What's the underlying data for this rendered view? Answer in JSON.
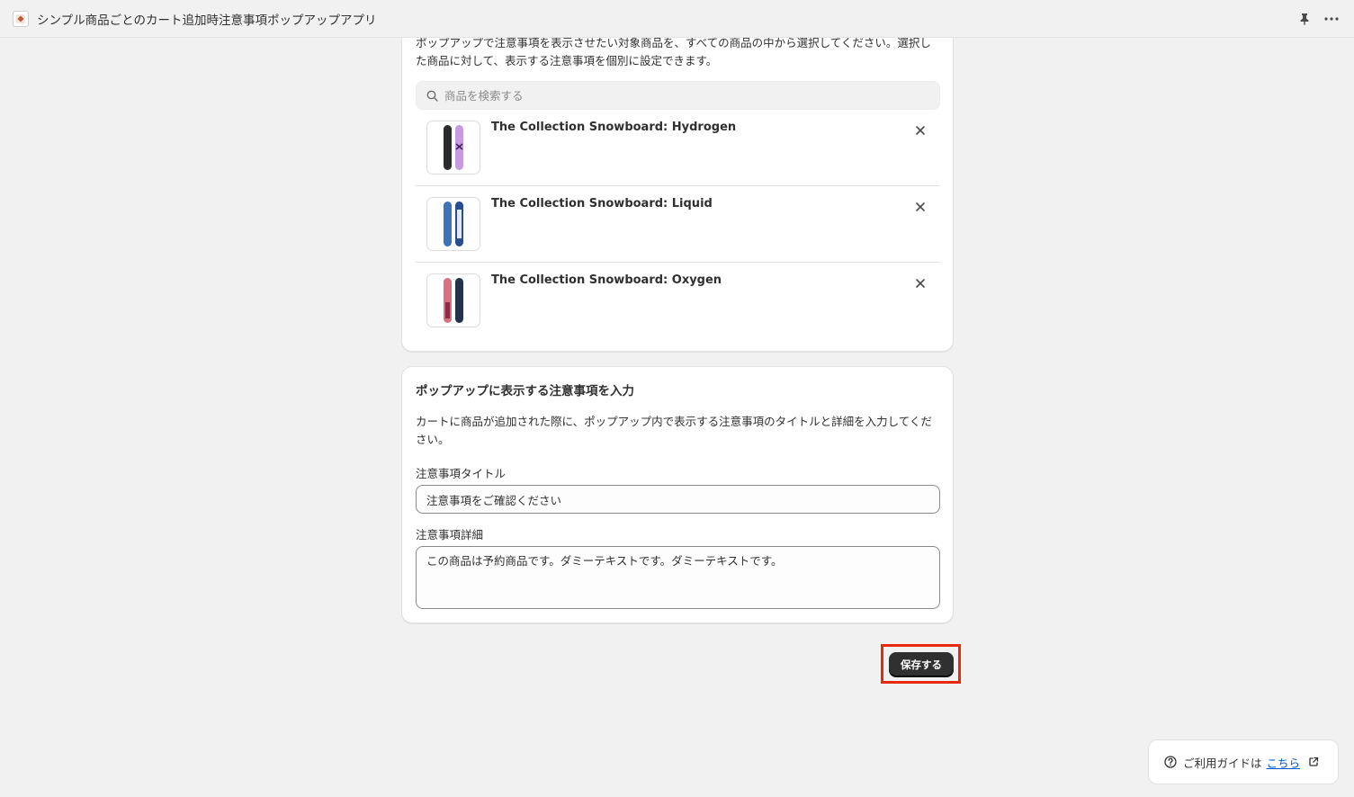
{
  "header": {
    "title": "シンプル商品ごとのカート追加時注意事項ポップアップアプリ",
    "icons": [
      "app-icon",
      "pin-icon",
      "more-icon"
    ]
  },
  "product_card": {
    "description": "ポップアップで注意事項を表示させたい対象商品を、すべての商品の中から選択してください。選択した商品に対して、表示する注意事項を個別に設定できます。",
    "search_placeholder": "商品を検索する",
    "products": [
      {
        "name": "The Collection Snowboard: Hydrogen",
        "colors": [
          "#2b2b2b",
          "#c79be0"
        ]
      },
      {
        "name": "The Collection Snowboard: Liquid",
        "colors": [
          "#3d74b8",
          "#2a4d8f"
        ]
      },
      {
        "name": "The Collection Snowboard: Oxygen",
        "colors": [
          "#d9727f",
          "#23344a"
        ]
      }
    ]
  },
  "notice_card": {
    "title": "ポップアップに表示する注意事項を入力",
    "description": "カートに商品が追加された際に、ポップアップ内で表示する注意事項のタイトルと詳細を入力してください。",
    "title_label": "注意事項タイトル",
    "title_value": "注意事項をご確認ください",
    "detail_label": "注意事項詳細",
    "detail_value": "この商品は予約商品です。ダミーテキストです。ダミーテキストです。"
  },
  "save_label": "保存する",
  "guide": {
    "text": "ご利用ガイドは",
    "link": "こちら"
  },
  "colors": {
    "primary_button": "#303030",
    "highlight": "#e8290b",
    "link": "#005bd3"
  }
}
